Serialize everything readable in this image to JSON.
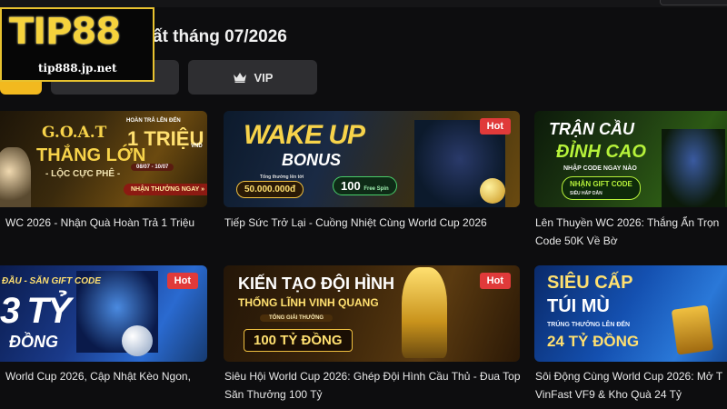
{
  "header": {
    "heading_text": "ất tháng 07/2026",
    "logo_text": "TIP88",
    "logo_url": "tip888.jp.net"
  },
  "tabs": [
    {
      "label": ""
    },
    {
      "label": ""
    },
    {
      "label": "VIP",
      "icon": "crown-icon"
    }
  ],
  "badge_label": "Hot",
  "cards": [
    {
      "caption": "WC 2026 - Nhận Quà Hoàn Trả 1 Triệu",
      "banner": {
        "line1": "G.O.A.T",
        "line2": "THẮNG LỚN",
        "line3": "- LỘC CỰC PHÊ -",
        "small": "HOÀN TRẢ LÊN ĐẾN",
        "big": "1 TRIỆU",
        "unit": "VND",
        "dates": "08/07 - 10/07",
        "cta": "NHẬN THƯỞNG NGAY »"
      }
    },
    {
      "caption": "Tiếp Sức Trở Lại - Cuồng Nhiệt Cùng World Cup 2026",
      "hot": true,
      "banner": {
        "line1": "WAKE UP",
        "line2": "BONUS",
        "small": "Tổng thưởng lên tới",
        "amount": "50.000.000đ",
        "spin": "100",
        "spin_unit": "Free Spin"
      }
    },
    {
      "caption": "Lên Thuyền WC 2026: Thắng Ẩn Trọn Code 50K Về Bờ",
      "banner": {
        "line1": "TRẬN CẦU",
        "line2": "ĐỈNH CAO",
        "small": "NHẬP CODE NGAY NÀO",
        "code_label": "NHẬN GIFT CODE",
        "code_sub": "SIÊU HẤP DẪN"
      }
    },
    {
      "caption": "World Cup 2026, Cập Nhật Kèo Ngon,",
      "hot": true,
      "banner": {
        "line1": "ĐẦU - SĂN GIFT CODE",
        "line2": "3 TỶ",
        "line3": "ĐỒNG"
      }
    },
    {
      "caption": "Siêu Hội World Cup 2026: Ghép Đội Hình Cầu Thủ - Đua Top Săn Thưởng 100 Tỷ",
      "hot": true,
      "banner": {
        "line1": "KIẾN TẠO ĐỘI HÌNH",
        "line2": "THỐNG LĨNH VINH QUANG",
        "small": "TỔNG GIẢI THƯỞNG",
        "amount": "100 TỶ ĐỒNG"
      }
    },
    {
      "caption": "Sôi Động Cùng World Cup 2026: Mở T VinFast VF9 & Kho Quà 24 Tỷ",
      "banner": {
        "line1": "SIÊU CẤP",
        "line2": "TÚI MÙ",
        "small": "TRÚNG THƯỞNG LÊN ĐẾN",
        "amount": "24 TỶ ĐỒNG"
      }
    }
  ]
}
